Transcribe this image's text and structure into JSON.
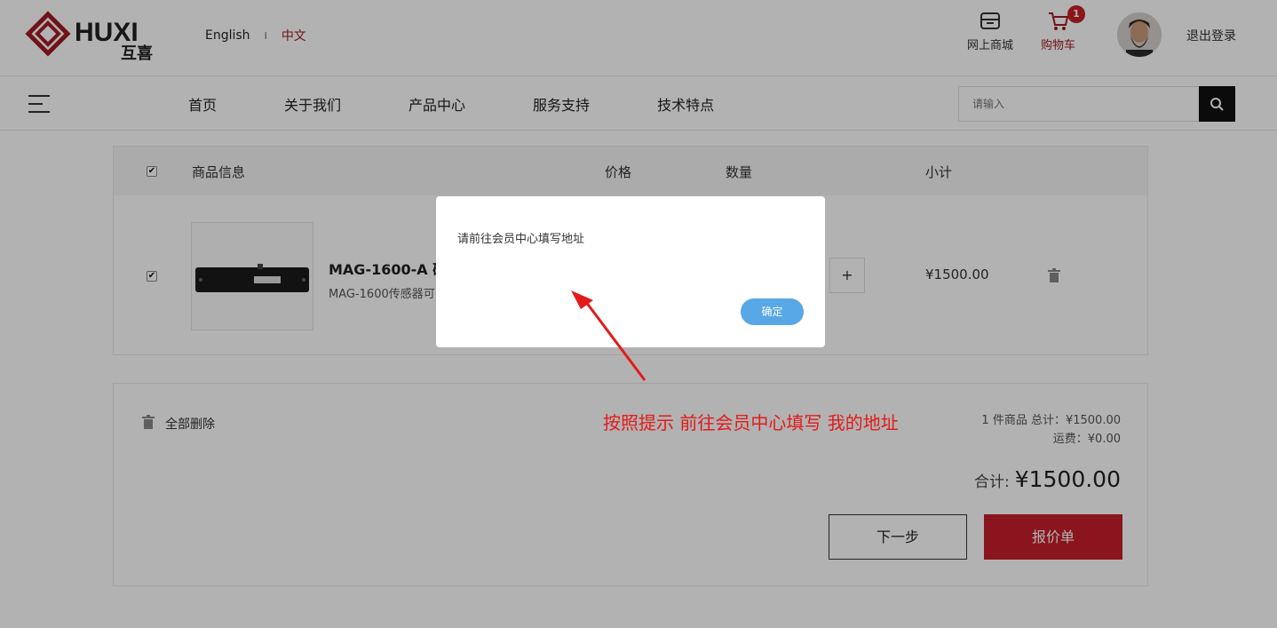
{
  "header": {
    "logo_text": "HUXI",
    "logo_sub": "互喜",
    "lang_english": "English",
    "lang_separator": "I",
    "lang_chinese": "中文",
    "shop_label": "网上商城",
    "cart_label": "购物车",
    "cart_count": "1",
    "logout_label": "退出登录"
  },
  "nav": {
    "items": [
      "首页",
      "关于我们",
      "产品中心",
      "服务支持",
      "技术特点"
    ],
    "search_placeholder": "请输入"
  },
  "cart": {
    "columns": {
      "product": "商品信息",
      "price": "价格",
      "quantity": "数量",
      "subtotal": "小计"
    },
    "item": {
      "checked": true,
      "title": "MAG-1600-A 磁",
      "description": "MAG-1600传感器可",
      "qty_plus": "+",
      "subtotal": "¥1500.00"
    }
  },
  "summary": {
    "delete_all": "全部删除",
    "count_total_line": "1 件商品 总计：¥1500.00",
    "shipping_line": "运费：¥0.00",
    "total_label": "合计:",
    "total_value": "¥1500.00",
    "next_button": "下一步",
    "quote_button": "报价单"
  },
  "dialog": {
    "message": "请前往会员中心填写地址",
    "ok_button": "确定"
  },
  "annotation": {
    "text": "按照提示 前往会员中心填写 我的地址",
    "color": "#e41a1a"
  },
  "colors": {
    "brand_red": "#a31b26",
    "quote_button": "#c61f2b",
    "dialog_ok": "#58a7e6"
  }
}
